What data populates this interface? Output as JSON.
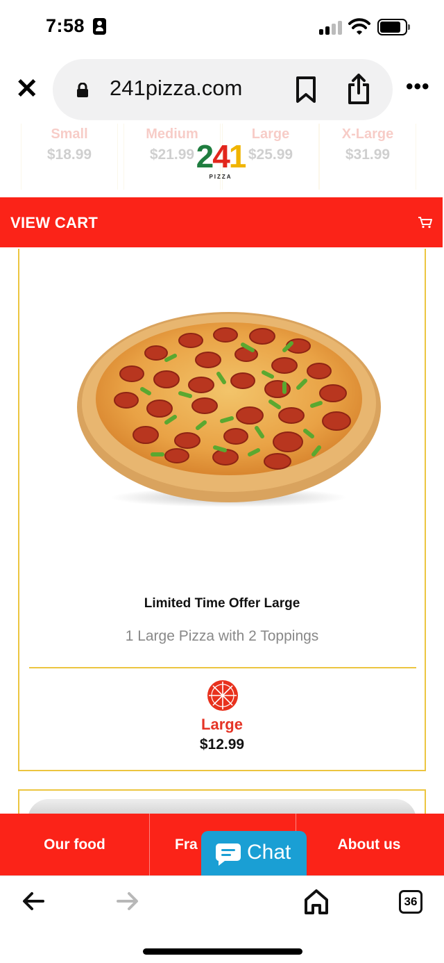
{
  "status_bar": {
    "time": "7:58"
  },
  "browser": {
    "url": "241pizza.com",
    "tab_count": "36"
  },
  "hidden_price_header": [
    {
      "size": "Small",
      "price": "$18.99"
    },
    {
      "size": "Medium",
      "price": "$21.99"
    },
    {
      "size": "Large",
      "price": "$25.99"
    },
    {
      "size": "X-Large",
      "price": "$31.99"
    }
  ],
  "logo": {
    "number_2": "2",
    "number_4": "4",
    "number_1": "1",
    "subtitle": "PIZZA"
  },
  "cart": {
    "label": "VIEW CART"
  },
  "product": {
    "title": "Limited Time Offer Large",
    "description": "1 Large Pizza with 2 Toppings",
    "size": "Large",
    "price": "$12.99"
  },
  "bottom_nav": {
    "items": [
      {
        "label": "Our food"
      },
      {
        "label": "Fra"
      },
      {
        "label": "About us"
      }
    ]
  },
  "chat": {
    "label": "Chat"
  },
  "colors": {
    "brand_red": "#fb2318",
    "card_border": "#ecc540",
    "chat_blue": "#1a9fd4",
    "logo_green": "#1f7d3f",
    "logo_red": "#e2261c",
    "logo_yellow": "#f0b400"
  },
  "icons": {
    "close": "close-icon",
    "lock": "lock-icon",
    "bookmark": "bookmark-icon",
    "share": "share-icon",
    "more": "more-icon",
    "cart": "cart-icon",
    "size": "pizza-slices-icon",
    "chat": "chat-bubble-icon",
    "back": "back-arrow-icon",
    "forward": "forward-arrow-icon",
    "home": "home-icon"
  }
}
